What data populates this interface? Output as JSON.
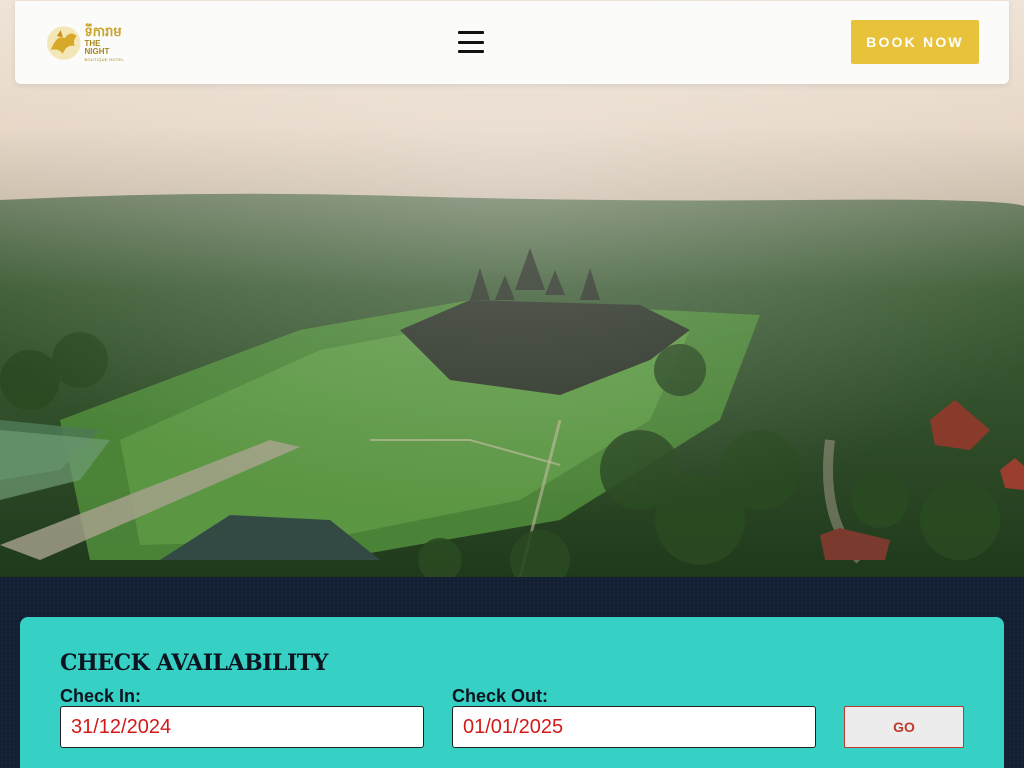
{
  "header": {
    "logo_script": "ទីការាម",
    "logo_name": "THE NIGHT",
    "logo_sub": "BOUTIQUE HOTEL",
    "book_label": "BOOK NOW"
  },
  "colors": {
    "accent": "#e9c23c",
    "panel": "#36d0c5",
    "date_text": "#d21a1a",
    "go_border": "#c0392b"
  },
  "availability": {
    "title": "CHECK AVAILABILITY",
    "check_in_label": "Check In:",
    "check_in_value": "31/12/2024",
    "check_out_label": "Check Out:",
    "check_out_value": "01/01/2025",
    "go_label": "GO"
  }
}
